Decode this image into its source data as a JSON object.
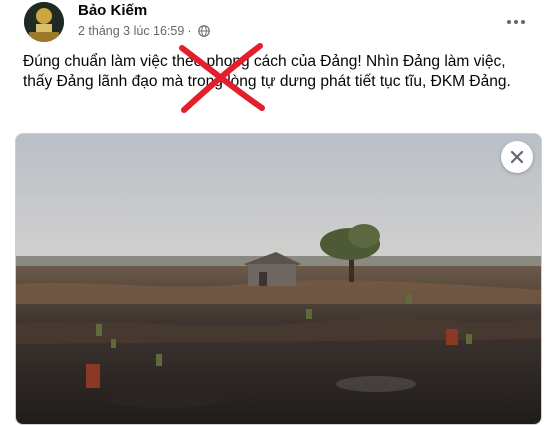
{
  "post": {
    "author": "Bảo Kiếm",
    "timestamp": "2 tháng 3 lúc 16:59",
    "separator": "·",
    "privacy_icon": "globe-icon",
    "more_icon": "more-horizontal-icon",
    "text": "Đúng chuẩn làm việc theo phong cách của Đảng! Nhìn Đảng làm việc, thấy Đảng lãnh đạo mà trong lòng tự dưng phát tiết tục tĩu, ĐKM Đảng.",
    "cross_color": "#e41e2b",
    "attachment": {
      "image_icon": "burned-land-photo",
      "close_icon": "close-icon"
    }
  },
  "colors": {
    "author": "#050505",
    "meta": "#65676b",
    "border": "#ced0d4"
  }
}
